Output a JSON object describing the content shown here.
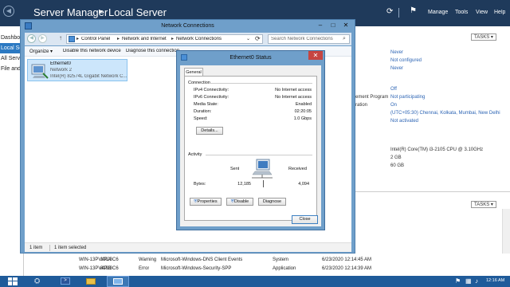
{
  "server_manager": {
    "breadcrumb_root": "Server Manager",
    "breadcrumb_sep": "▸",
    "breadcrumb_page": "Local Server",
    "menu": [
      "Manage",
      "Tools",
      "View",
      "Help"
    ],
    "nav": [
      "Dashboard",
      "Local Server",
      "All Servers",
      "File and S"
    ],
    "tasks_label": "TASKS",
    "properties_top": [
      "Never",
      "Not configured",
      "Never"
    ],
    "properties_mid_labels": [
      "ement Program",
      "ration"
    ],
    "properties_mid_values": [
      "Off",
      "Not participating",
      "On",
      "(UTC+05:30) Chennai, Kolkata, Mumbai, New Delhi",
      "Not activated"
    ],
    "properties_hw": [
      "Intel(R) Core(TM) i3-2105 CPU @ 3.10GHz",
      "2 GB",
      "60 GB"
    ],
    "events": [
      {
        "server": "WIN-13PV4PJ3C6",
        "id": "1014",
        "severity": "Warning",
        "source": "Microsoft-Windows-DNS Client Events",
        "log": "System",
        "date": "6/23/2020 12:14:45 AM"
      },
      {
        "server": "WIN-13PV4PJ3C6",
        "id": "8198",
        "severity": "Error",
        "source": "Microsoft-Windows-Security-SPP",
        "log": "Application",
        "date": "6/23/2020 12:14:39 AM"
      }
    ]
  },
  "network_connections": {
    "title": "Network Connections",
    "address": [
      "Control Panel",
      "Network and Internet",
      "Network Connections"
    ],
    "search_placeholder": "Search Network Connections",
    "toolbar": [
      "Organize",
      "Disable this network device",
      "Diagnose this connection"
    ],
    "adapter": {
      "name": "Ethernet0",
      "network": "Network  2",
      "device": "Intel(R) 82574L Gigabit Network C..."
    },
    "status_items": "1 item",
    "status_selected": "1 item selected"
  },
  "status_dialog": {
    "title": "Ethernet0 Status",
    "tab": "General",
    "connection_group": "Connection",
    "rows": [
      {
        "label": "IPv4 Connectivity:",
        "value": "No Internet access"
      },
      {
        "label": "IPv6 Connectivity:",
        "value": "No Internet access"
      },
      {
        "label": "Media State:",
        "value": "Enabled"
      },
      {
        "label": "Duration:",
        "value": "02:20:05"
      },
      {
        "label": "Speed:",
        "value": "1.0 Gbps"
      }
    ],
    "details_button": "Details...",
    "activity_group": "Activity",
    "sent_label": "Sent",
    "received_label": "Received",
    "bytes_label": "Bytes:",
    "bytes_sent": "12,185",
    "bytes_received": "4,094",
    "properties_button": "Properties",
    "disable_button": "Disable",
    "diagnose_button": "Diagnose",
    "close_button": "Close"
  },
  "taskbar": {
    "clock_time": "12:16 AM"
  },
  "colors": {
    "title_blue": "#6f9fca",
    "header_navy": "#1f3a5b",
    "nav_active": "#2b79c2",
    "link_blue": "#2c64b4",
    "taskbar": "#1f5b9a",
    "close_red": "#c64541"
  }
}
